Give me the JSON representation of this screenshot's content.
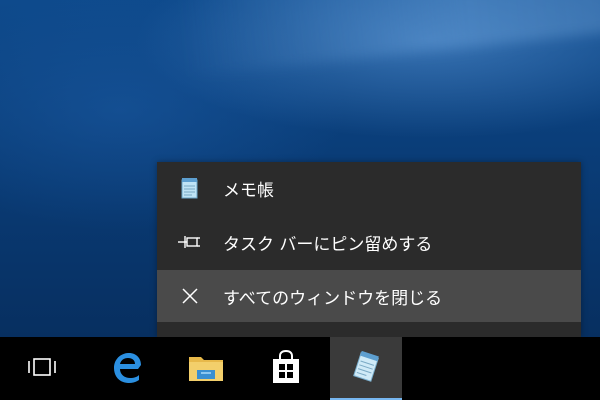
{
  "jumplist": {
    "items": [
      {
        "icon": "notepad-icon",
        "label": "メモ帳"
      },
      {
        "icon": "pin-icon",
        "label": "タスク バーにピン留めする"
      },
      {
        "icon": "close-icon",
        "label": "すべてのウィンドウを閉じる"
      }
    ]
  },
  "taskbar": {
    "buttons": [
      {
        "icon": "task-view-icon"
      },
      {
        "icon": "edge-icon"
      },
      {
        "icon": "file-explorer-icon"
      },
      {
        "icon": "store-icon"
      },
      {
        "icon": "notepad-icon",
        "active": true
      }
    ]
  },
  "colors": {
    "menu_background": "#2b2b2b",
    "menu_hover": "#4a4a4a",
    "taskbar_background": "#000000",
    "active_indicator": "#77b7f0"
  }
}
